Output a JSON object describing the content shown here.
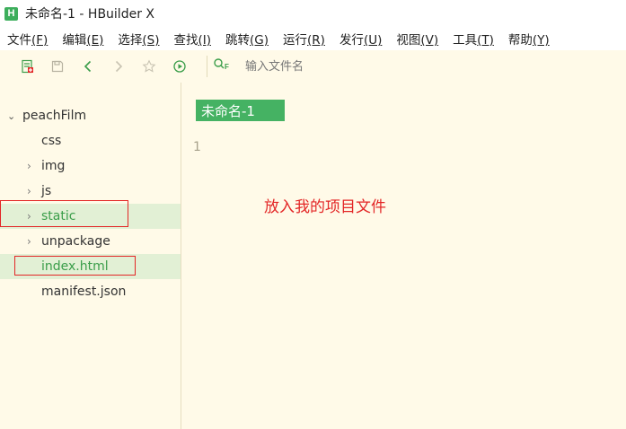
{
  "window": {
    "logo_letter": "H",
    "title": "未命名-1 - HBuilder X"
  },
  "menu": [
    {
      "label": "文件",
      "key": "(F)"
    },
    {
      "label": "编辑",
      "key": "(E)"
    },
    {
      "label": "选择",
      "key": "(S)"
    },
    {
      "label": "查找",
      "key": "(I)"
    },
    {
      "label": "跳转",
      "key": "(G)"
    },
    {
      "label": "运行",
      "key": "(R)"
    },
    {
      "label": "发行",
      "key": "(U)"
    },
    {
      "label": "视图",
      "key": "(V)"
    },
    {
      "label": "工具",
      "key": "(T)"
    },
    {
      "label": "帮助",
      "key": "(Y)"
    }
  ],
  "toolbar": {
    "search_placeholder": "输入文件名"
  },
  "sidebar": {
    "project": "peachFilm",
    "items": [
      {
        "label": "css"
      },
      {
        "label": "img"
      },
      {
        "label": "js"
      },
      {
        "label": "static"
      },
      {
        "label": "unpackage"
      },
      {
        "label": "index.html"
      },
      {
        "label": "manifest.json"
      }
    ]
  },
  "editor": {
    "tab_label": "未命名-1",
    "line_number": "1",
    "annotation": "放入我的项目文件"
  },
  "colors": {
    "accent_green": "#45b263",
    "highlight_bg": "#e2f0d5",
    "annotation_red": "#e32626",
    "editor_bg": "#fffae8"
  }
}
